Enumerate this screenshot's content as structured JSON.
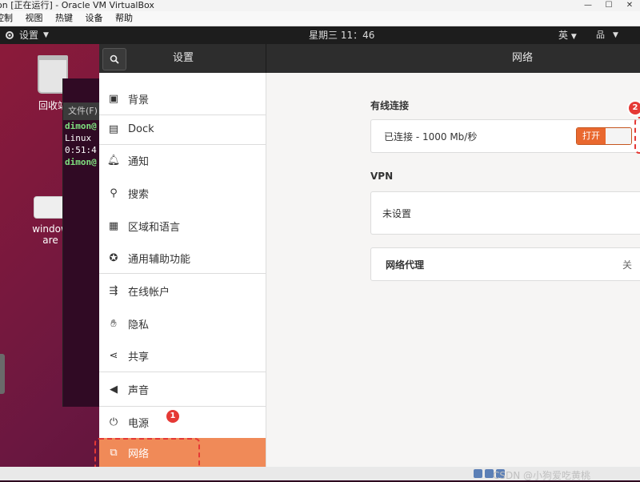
{
  "vbox": {
    "title": "on [正在运行] - Oracle VM VirtualBox",
    "menu": [
      "控制",
      "视图",
      "热键",
      "设备",
      "帮助"
    ],
    "win_buttons": [
      "—",
      "☐",
      "✕"
    ]
  },
  "topbar": {
    "app_menu": "设置",
    "clock": "星期三 11：46",
    "ime": "英"
  },
  "desktop": {
    "trash_label": "回收站",
    "window_icon_label_line1": "window",
    "window_icon_label_line2": "are"
  },
  "terminal": {
    "title": "文件(F)",
    "lines": [
      "dimon@",
      "Linux",
      "0:51:4",
      "dimon@"
    ]
  },
  "settings": {
    "header_title": "设置",
    "panel_title": "网络",
    "sidebar": [
      {
        "label": "背景",
        "icon": "background-icon"
      },
      {
        "label": "Dock",
        "icon": "dock-icon"
      },
      {
        "label": "通知",
        "icon": "bell-icon"
      },
      {
        "label": "搜索",
        "icon": "search-icon"
      },
      {
        "label": "区域和语言",
        "icon": "region-icon"
      },
      {
        "label": "通用辅助功能",
        "icon": "accessibility-icon"
      },
      {
        "label": "在线帐户",
        "icon": "online-accounts-icon"
      },
      {
        "label": "隐私",
        "icon": "privacy-hand-icon"
      },
      {
        "label": "共享",
        "icon": "share-icon"
      },
      {
        "label": "声音",
        "icon": "speaker-icon"
      },
      {
        "label": "电源",
        "icon": "power-icon"
      },
      {
        "label": "网络",
        "icon": "network-icon",
        "active": true
      }
    ],
    "network": {
      "wired_label": "有线连接",
      "wired_status": "已连接 - 1000 Mb/秒",
      "toggle_label": "打开",
      "vpn_label": "VPN",
      "vpn_status": "未设置",
      "proxy_label": "网络代理",
      "proxy_value": "关"
    }
  },
  "annotations": {
    "marker1": "1",
    "marker2": "2",
    "color": "#e53935"
  },
  "watermark": "CSDN @小狗爱吃黄桃",
  "colors": {
    "accent": "#f08a58",
    "toggle_on": "#e9682f",
    "header": "#2d2d2d"
  }
}
